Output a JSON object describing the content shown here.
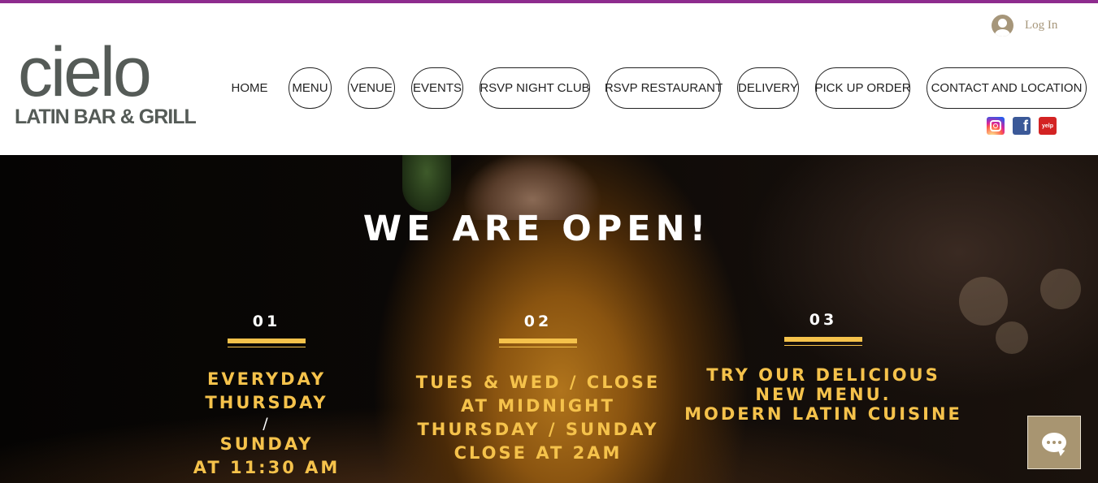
{
  "brand": {
    "logo_word": "cielo",
    "logo_sub": "LATIN BAR & GRILL"
  },
  "header": {
    "login_label": "Log In",
    "nav": [
      {
        "label": "HOME"
      },
      {
        "label": "MENU"
      },
      {
        "label": "VENUE"
      },
      {
        "label": "EVENTS"
      },
      {
        "label": "RSVP NIGHT CLUB"
      },
      {
        "label": "RSVP RESTAURANT"
      },
      {
        "label": "DELIVERY"
      },
      {
        "label": "PICK UP ORDER"
      },
      {
        "label": "CONTACT AND LOCATION"
      }
    ],
    "social": [
      {
        "icon": "instagram-icon"
      },
      {
        "icon": "facebook-icon",
        "glyph": "f"
      },
      {
        "icon": "yelp-icon",
        "glyph": "yelp"
      }
    ]
  },
  "hero": {
    "title": "WE ARE OPEN!",
    "columns": [
      {
        "number": "01",
        "lines": [
          "EVERYDAY",
          "THURSDAY",
          "/",
          "SUNDAY",
          "AT 11:30 AM"
        ]
      },
      {
        "number": "02",
        "lines": [
          "TUES & WED / CLOSE",
          "AT MIDNIGHT",
          "THURSDAY / SUNDAY",
          "CLOSE AT 2AM"
        ]
      },
      {
        "number": "03",
        "lines": [
          "TRY OUR DELICIOUS",
          "NEW MENU.",
          "MODERN LATIN CUISINE"
        ]
      }
    ]
  },
  "colors": {
    "accent_top": "#8e2b8e",
    "gold": "#f5c24b",
    "login": "#a6967a",
    "chat": "#a89571"
  }
}
